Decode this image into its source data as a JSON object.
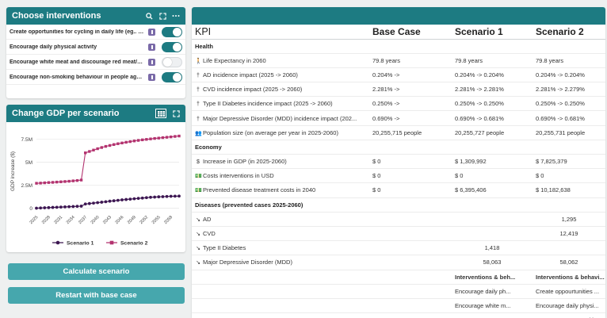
{
  "interventions": {
    "title": "Choose interventions",
    "icons": [
      "search-icon",
      "expand-icon",
      "more-icon"
    ],
    "items": [
      {
        "label": "Create opportunities for cycling in daily life (eg.. as ...",
        "enabled": true
      },
      {
        "label": "Encourage daily physical activity",
        "enabled": true
      },
      {
        "label": "Encourage white meat and discourage red meat/proce...",
        "enabled": false
      },
      {
        "label": "Encourage non-smoking behaviour in people aged 55 ...",
        "enabled": true
      }
    ]
  },
  "gdp_panel": {
    "title": "Change GDP per scenario"
  },
  "chart_data": {
    "type": "line",
    "ylabel": "GDP increase ($)",
    "xlabel": "",
    "y_ticks": [
      "0",
      "2.5M",
      "5M",
      "7.5M"
    ],
    "ylim": [
      -300000,
      8300000
    ],
    "x": [
      2025,
      2026,
      2027,
      2028,
      2029,
      2030,
      2031,
      2032,
      2033,
      2034,
      2035,
      2036,
      2037,
      2038,
      2039,
      2040,
      2041,
      2042,
      2043,
      2044,
      2045,
      2046,
      2047,
      2048,
      2049,
      2050,
      2051,
      2052,
      2053,
      2054,
      2055,
      2056,
      2057,
      2058,
      2059,
      2060
    ],
    "x_tick_labels": [
      "2025",
      "2028",
      "2031",
      "2034",
      "2037",
      "2040",
      "2043",
      "2046",
      "2049",
      "2052",
      "2055",
      "2058"
    ],
    "series": [
      {
        "name": "Scenario 1",
        "color": "#3d1752",
        "marker": "circle",
        "values": [
          0,
          20000,
          40000,
          60000,
          80000,
          100000,
          120000,
          140000,
          160000,
          180000,
          200000,
          220000,
          450000,
          500000,
          550000,
          600000,
          650000,
          700000,
          760000,
          800000,
          850000,
          900000,
          940000,
          980000,
          1020000,
          1060000,
          1100000,
          1140000,
          1180000,
          1200000,
          1230000,
          1250000,
          1270000,
          1290000,
          1300000,
          1310000
        ]
      },
      {
        "name": "Scenario 2",
        "color": "#b3336f",
        "marker": "square",
        "values": [
          2700000,
          2720000,
          2750000,
          2780000,
          2800000,
          2830000,
          2860000,
          2890000,
          2920000,
          2960000,
          3000000,
          3050000,
          6000000,
          6150000,
          6300000,
          6450000,
          6580000,
          6700000,
          6800000,
          6900000,
          6990000,
          7070000,
          7150000,
          7220000,
          7290000,
          7350000,
          7410000,
          7460000,
          7510000,
          7560000,
          7600000,
          7650000,
          7690000,
          7730000,
          7780000,
          7825000
        ]
      }
    ],
    "legend": "bottom"
  },
  "buttons": {
    "calculate": "Calculate scenario",
    "restart": "Restart with base case"
  },
  "kpi_table": {
    "headers": [
      "KPI",
      "Base Case",
      "Scenario 1",
      "Scenario 2"
    ],
    "rows": [
      {
        "type": "section",
        "label": "Health"
      },
      {
        "type": "row",
        "icon": "person-icon",
        "glyph": "🚶",
        "kpi": "Life Expectancy in 2060",
        "base": "79.8 years",
        "s1": "79.8 years",
        "s2": "79.8 years"
      },
      {
        "type": "row",
        "icon": "person-icon",
        "glyph": "†",
        "kpi": "AD incidence impact (2025 -> 2060)",
        "base": "0.204% ->",
        "s1": "0.204% -> 0.204%",
        "s2": "0.204% -> 0.204%"
      },
      {
        "type": "row",
        "icon": "person-icon",
        "glyph": "†",
        "kpi": "CVD incidence impact (2025 -> 2060)",
        "base": "2.281% ->",
        "s1": "2.281% -> 2.281%",
        "s2": "2.281% -> 2.279%"
      },
      {
        "type": "row",
        "icon": "person-icon",
        "glyph": "†",
        "kpi": "Type II Diabetes incidence impact (2025 -> 2060)",
        "base": "0.250% ->",
        "s1": "0.250% -> 0.250%",
        "s2": "0.250% -> 0.250%"
      },
      {
        "type": "row",
        "icon": "person-icon",
        "glyph": "†",
        "kpi": "Major Depressive Disorder (MDD) incidence impact (202...",
        "base": "0.690% ->",
        "s1": "0.690% -> 0.681%",
        "s2": "0.690% -> 0.681%"
      },
      {
        "type": "row",
        "icon": "people-icon",
        "glyph": "👥",
        "kpi": "Population size (on average per year in 2025-2060)",
        "base": "20,255,715 people",
        "s1": "20,255,727 people",
        "s2": "20,255,731 people"
      },
      {
        "type": "section",
        "label": "Economy"
      },
      {
        "type": "row",
        "icon": "dollar-icon",
        "glyph": "$",
        "kpi": "Increase in GDP (in 2025-2060)",
        "base": "$ 0",
        "s1": "$ 1,309,992",
        "s2": "$ 7,825,379"
      },
      {
        "type": "row",
        "icon": "money-icon",
        "glyph": "💵",
        "kpi": "Costs interventions in USD",
        "base": "$ 0",
        "s1": "$ 0",
        "s2": "$ 0"
      },
      {
        "type": "row",
        "icon": "money-icon",
        "glyph": "💵",
        "kpi": "Prevented disease treatment costs in 2040",
        "base": "$ 0",
        "s1": "$ 6,395,406",
        "s2": "$ 10,182,638"
      },
      {
        "type": "section",
        "label": "Diseases (prevented cases 2025-2060)"
      },
      {
        "type": "row",
        "icon": "trend-down-icon",
        "glyph": "↘",
        "kpi": "AD",
        "base": "",
        "s1": "",
        "s2": "1,295",
        "center": true
      },
      {
        "type": "row",
        "icon": "trend-down-icon",
        "glyph": "↘",
        "kpi": "CVD",
        "base": "",
        "s1": "",
        "s2": "12,419",
        "center": true
      },
      {
        "type": "row",
        "icon": "trend-down-icon",
        "glyph": "↘",
        "kpi": "Type II Diabetes",
        "base": "",
        "s1": "1,418",
        "s2": "",
        "center": true
      },
      {
        "type": "row",
        "icon": "trend-down-icon",
        "glyph": "↘",
        "kpi": "Major Depressive Disorder (MDD)",
        "base": "",
        "s1": "58,063",
        "s2": "58,062",
        "center": true
      },
      {
        "type": "row",
        "kpi": "",
        "base": "",
        "s1": "Interventions & beh...",
        "s2": "Interventions & behavi...",
        "bold": true
      },
      {
        "type": "row",
        "kpi": "",
        "base": "",
        "s1": "Encourage daily ph...",
        "s2": "Create oppourtunities ..."
      },
      {
        "type": "row",
        "kpi": "",
        "base": "",
        "s1": "Encourage white m...",
        "s2": "Encourage daily physi..."
      },
      {
        "type": "row",
        "kpi": "",
        "base": "",
        "s1": "",
        "s2": "Encourage non-smoki..."
      }
    ]
  },
  "colors": {
    "header": "#1d7b82",
    "button": "#46a7ad",
    "info": "#7a6aa8"
  }
}
